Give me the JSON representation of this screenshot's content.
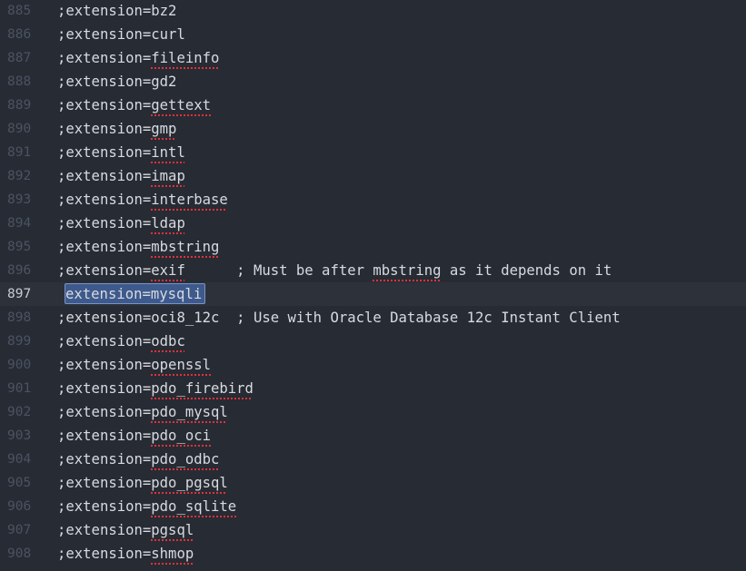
{
  "lines": [
    {
      "number": "885",
      "prefix": ";extension=",
      "word": "bz2",
      "misspelled": false,
      "comment": ""
    },
    {
      "number": "886",
      "prefix": ";extension=",
      "word": "curl",
      "misspelled": false,
      "comment": ""
    },
    {
      "number": "887",
      "prefix": ";extension=",
      "word": "fileinfo",
      "misspelled": true,
      "comment": ""
    },
    {
      "number": "888",
      "prefix": ";extension=",
      "word": "gd2",
      "misspelled": false,
      "comment": ""
    },
    {
      "number": "889",
      "prefix": ";extension=",
      "word": "gettext",
      "misspelled": true,
      "comment": ""
    },
    {
      "number": "890",
      "prefix": ";extension=",
      "word": "gmp",
      "misspelled": true,
      "comment": ""
    },
    {
      "number": "891",
      "prefix": ";extension=",
      "word": "intl",
      "misspelled": true,
      "comment": ""
    },
    {
      "number": "892",
      "prefix": ";extension=",
      "word": "imap",
      "misspelled": true,
      "comment": ""
    },
    {
      "number": "893",
      "prefix": ";extension=",
      "word": "interbase",
      "misspelled": true,
      "comment": ""
    },
    {
      "number": "894",
      "prefix": ";extension=",
      "word": "ldap",
      "misspelled": true,
      "comment": ""
    },
    {
      "number": "895",
      "prefix": ";extension=",
      "word": "mbstring",
      "misspelled": true,
      "comment": ""
    },
    {
      "number": "896",
      "prefix": ";extension=",
      "word": "exif",
      "misspelled": true,
      "comment": "      ; Must be after mbstring as it depends on it"
    },
    {
      "number": "897",
      "prefix": "extension=",
      "word": "mysqli",
      "misspelled": false,
      "comment": "",
      "current": true
    },
    {
      "number": "898",
      "prefix": ";extension=",
      "word": "oci8_12c",
      "misspelled": false,
      "comment": "  ; Use with Oracle Database 12c Instant Client"
    },
    {
      "number": "899",
      "prefix": ";extension=",
      "word": "odbc",
      "misspelled": true,
      "comment": ""
    },
    {
      "number": "900",
      "prefix": ";extension=",
      "word": "openssl",
      "misspelled": true,
      "comment": ""
    },
    {
      "number": "901",
      "prefix": ";extension=",
      "word": "pdo_firebird",
      "misspelled": true,
      "comment": ""
    },
    {
      "number": "902",
      "prefix": ";extension=",
      "word": "pdo_mysql",
      "misspelled": true,
      "comment": ""
    },
    {
      "number": "903",
      "prefix": ";extension=",
      "word": "pdo_oci",
      "misspelled": true,
      "comment": ""
    },
    {
      "number": "904",
      "prefix": ";extension=",
      "word": "pdo_odbc",
      "misspelled": true,
      "comment": ""
    },
    {
      "number": "905",
      "prefix": ";extension=",
      "word": "pdo_pgsql",
      "misspelled": true,
      "comment": ""
    },
    {
      "number": "906",
      "prefix": ";extension=",
      "word": "pdo_sqlite",
      "misspelled": true,
      "comment": ""
    },
    {
      "number": "907",
      "prefix": ";extension=",
      "word": "pgsql",
      "misspelled": true,
      "comment": ""
    },
    {
      "number": "908",
      "prefix": ";extension=",
      "word": "shmop",
      "misspelled": true,
      "comment": ""
    }
  ],
  "colors": {
    "background": "#272b33",
    "text": "#d7dae0",
    "gutter": "#4b5363",
    "selection": "#3e5a8c",
    "spellcheck": "#e0313c"
  }
}
